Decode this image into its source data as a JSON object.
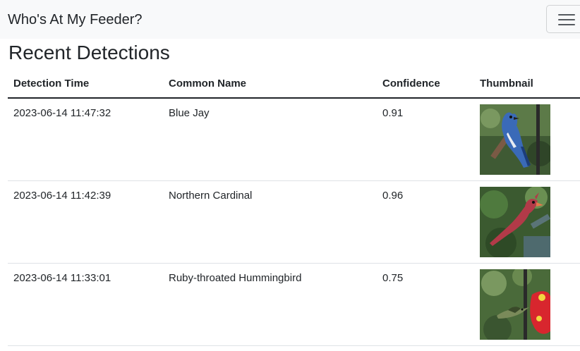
{
  "navbar": {
    "brand": "Who's At My Feeder?"
  },
  "main": {
    "title": "Recent Detections",
    "table": {
      "headers": [
        "Detection Time",
        "Common Name",
        "Confidence",
        "Thumbnail"
      ],
      "rows": [
        {
          "time": "2023-06-14 11:47:32",
          "name": "Blue Jay",
          "confidence": "0.91",
          "thumbnail": "blue-jay-photo"
        },
        {
          "time": "2023-06-14 11:42:39",
          "name": "Northern Cardinal",
          "confidence": "0.96",
          "thumbnail": "northern-cardinal-photo"
        },
        {
          "time": "2023-06-14 11:33:01",
          "name": "Ruby-throated Hummingbird",
          "confidence": "0.75",
          "thumbnail": "hummingbird-photo"
        }
      ]
    }
  },
  "colors": {
    "navbar_bg": "#f8f9fa",
    "text": "#212529",
    "row_border": "#dee2e6"
  }
}
